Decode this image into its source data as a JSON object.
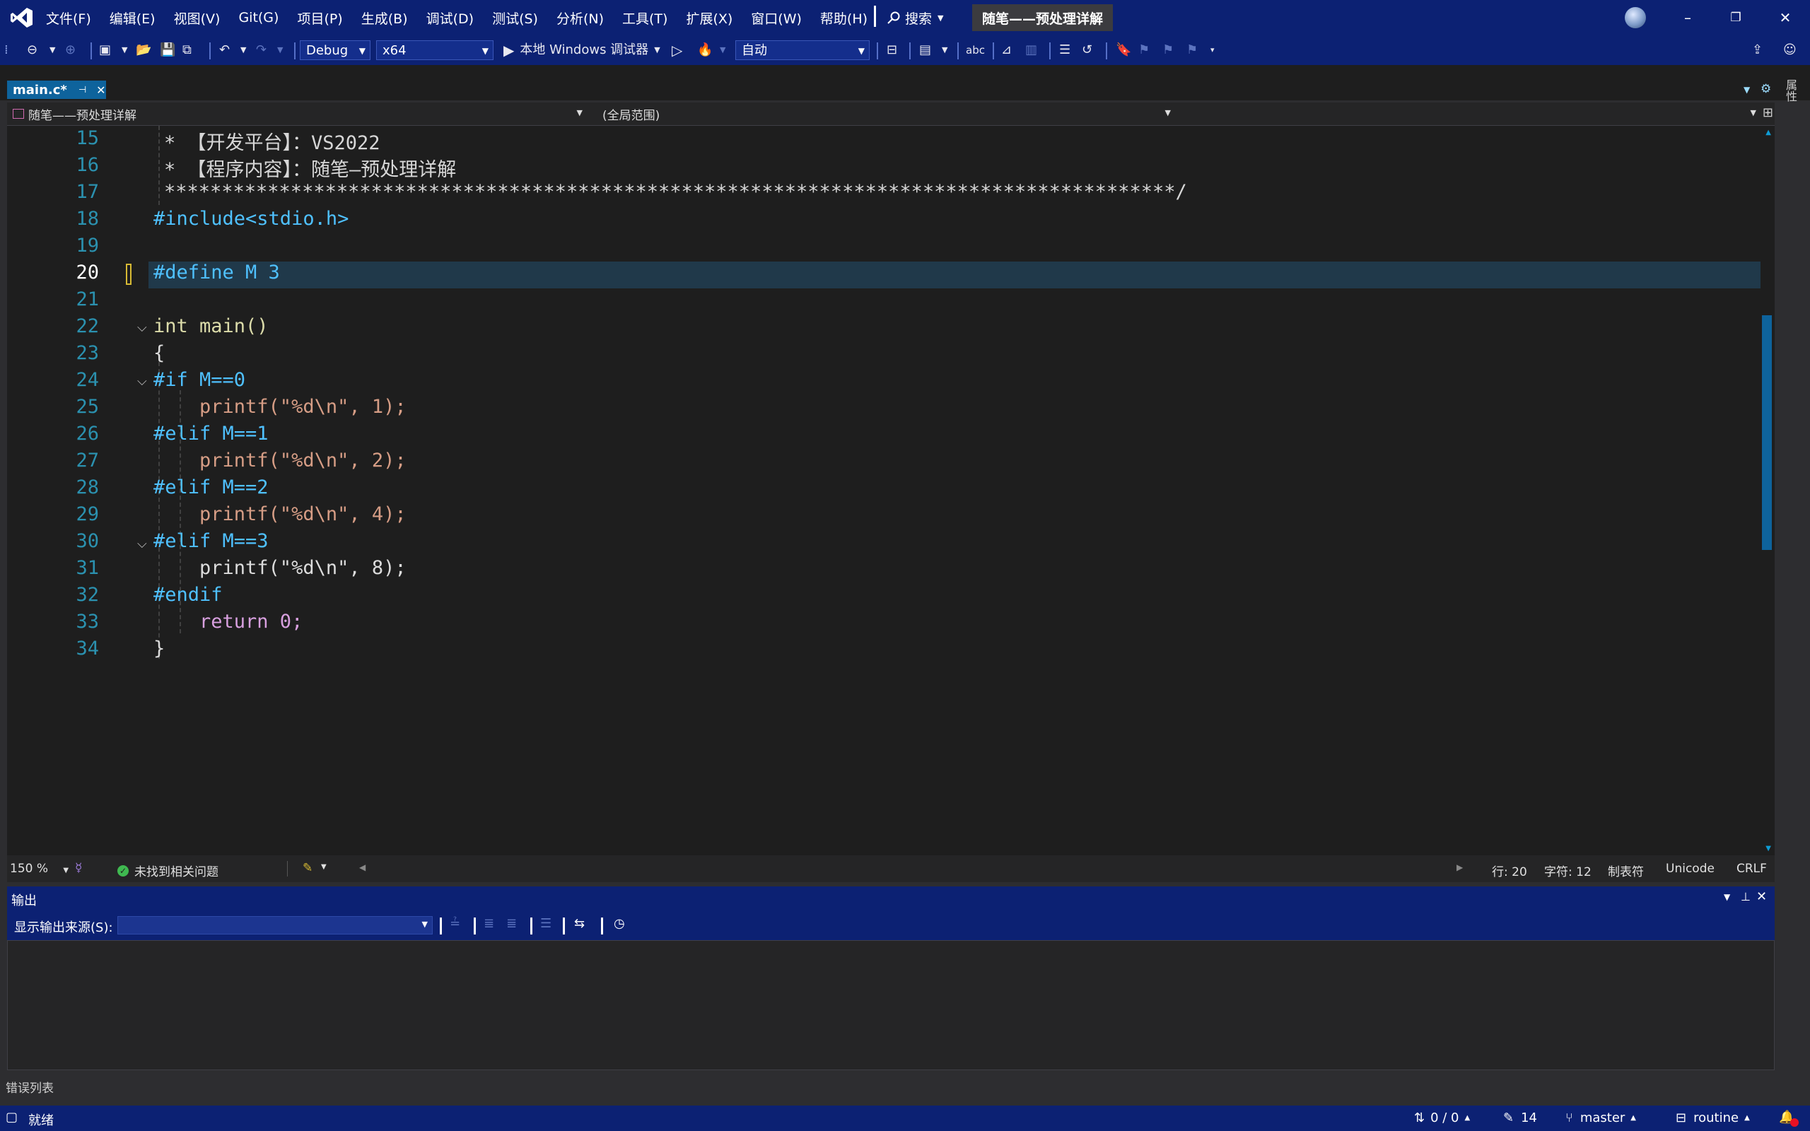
{
  "menu": [
    "文件(F)",
    "编辑(E)",
    "视图(V)",
    "Git(G)",
    "项目(P)",
    "生成(B)",
    "调试(D)",
    "测试(S)",
    "分析(N)",
    "工具(T)",
    "扩展(X)",
    "窗口(W)",
    "帮助(H)"
  ],
  "search_label": "搜索",
  "window_title": "随笔——预处理详解",
  "toolbar": {
    "config": "Debug",
    "platform": "x64",
    "debugger": "本地 Windows 调试器",
    "mode": "自动"
  },
  "tab": {
    "label": "main.c*"
  },
  "side_panel_label": "属性",
  "nav": {
    "project": "随笔——预处理详解",
    "scope": "(全局范围)",
    "member": ""
  },
  "editor": {
    "line_numbers": [
      "15",
      "16",
      "17",
      "18",
      "19",
      "20",
      "21",
      "22",
      "23",
      "24",
      "25",
      "26",
      "27",
      "28",
      "29",
      "30",
      "31",
      "32",
      "33",
      "34"
    ],
    "current_line": "20",
    "lines": [
      "* 【开发平台】：VS2022",
      "* 【程序内容】：随笔—预处理详解",
      "****************************************************************************************/",
      "#include<stdio.h>",
      "",
      "#define M 3",
      "",
      "int main()",
      "{",
      "#if M==0",
      "    printf(\"%d\\n\", 1);",
      "#elif M==1",
      "    printf(\"%d\\n\", 2);",
      "#elif M==2",
      "    printf(\"%d\\n\", 4);",
      "#elif M==3",
      "    printf(\"%d\\n\", 8);",
      "#endif",
      "    return 0;",
      "}"
    ]
  },
  "editor_status": {
    "zoom": "150 %",
    "issues": "未找到相关问题",
    "line": "行: 20",
    "char": "字符: 12",
    "indent": "制表符",
    "encoding": "Unicode",
    "eol": "CRLF"
  },
  "output": {
    "title": "输出",
    "source_label": "显示输出来源(S):",
    "source_value": ""
  },
  "error_list": "错误列表",
  "statusbar": {
    "ready": "就绪",
    "changes": "0 / 0",
    "edits": "14",
    "branch": "master",
    "repo": "routine"
  },
  "colors": {
    "title_bar": "#0c2173",
    "editor_bg": "#1e1e1e",
    "current_line": "#20394a",
    "line_number": "#2b91af",
    "accent": "#0e639c"
  }
}
